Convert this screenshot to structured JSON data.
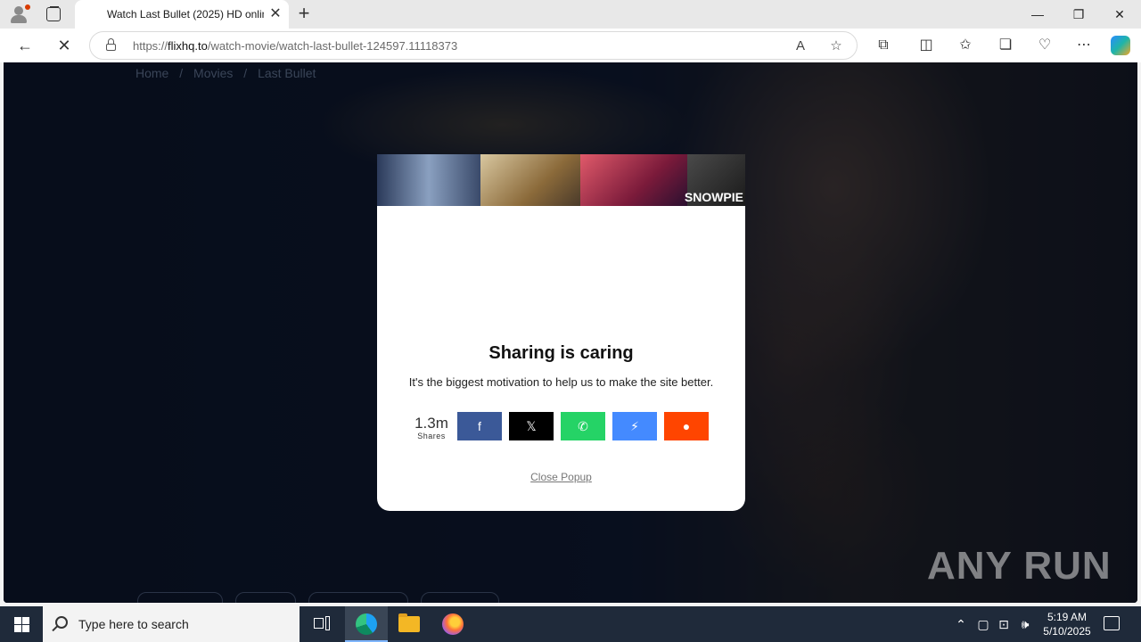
{
  "browser": {
    "tab_title": "Watch Last Bullet (2025) HD onlin",
    "url_prefix": "https://",
    "url_host": "flixhq.to",
    "url_path": "/watch-movie/watch-last-bullet-124597.11118373",
    "tab_close": "✕",
    "new_tab": "+",
    "minimize": "—",
    "restore": "❐",
    "close": "✕"
  },
  "breadcrumb": [
    "Home",
    "/",
    "Movies",
    "/",
    "Last Bullet"
  ],
  "popup": {
    "banner_text": "SNOWPIE",
    "title": "Sharing is caring",
    "subtitle": "It's the biggest motivation to help us to make the site better.",
    "share_count": "1.3m",
    "share_count_label": "Shares",
    "share_buttons": [
      {
        "network": "facebook",
        "glyph": "f",
        "color": "#3b5998"
      },
      {
        "network": "x",
        "glyph": "𝕏",
        "color": "#000000"
      },
      {
        "network": "whatsapp",
        "glyph": "✆",
        "color": "#25d366"
      },
      {
        "network": "messenger",
        "glyph": "⚡",
        "color": "#448aff"
      },
      {
        "network": "reddit",
        "glyph": "●",
        "color": "#ff4500"
      }
    ],
    "close_label": "Close Popup"
  },
  "watermark": "ANY  RUN",
  "taskbar": {
    "search_placeholder": "Type here to search",
    "time": "5:19 AM",
    "date": "5/10/2025"
  }
}
